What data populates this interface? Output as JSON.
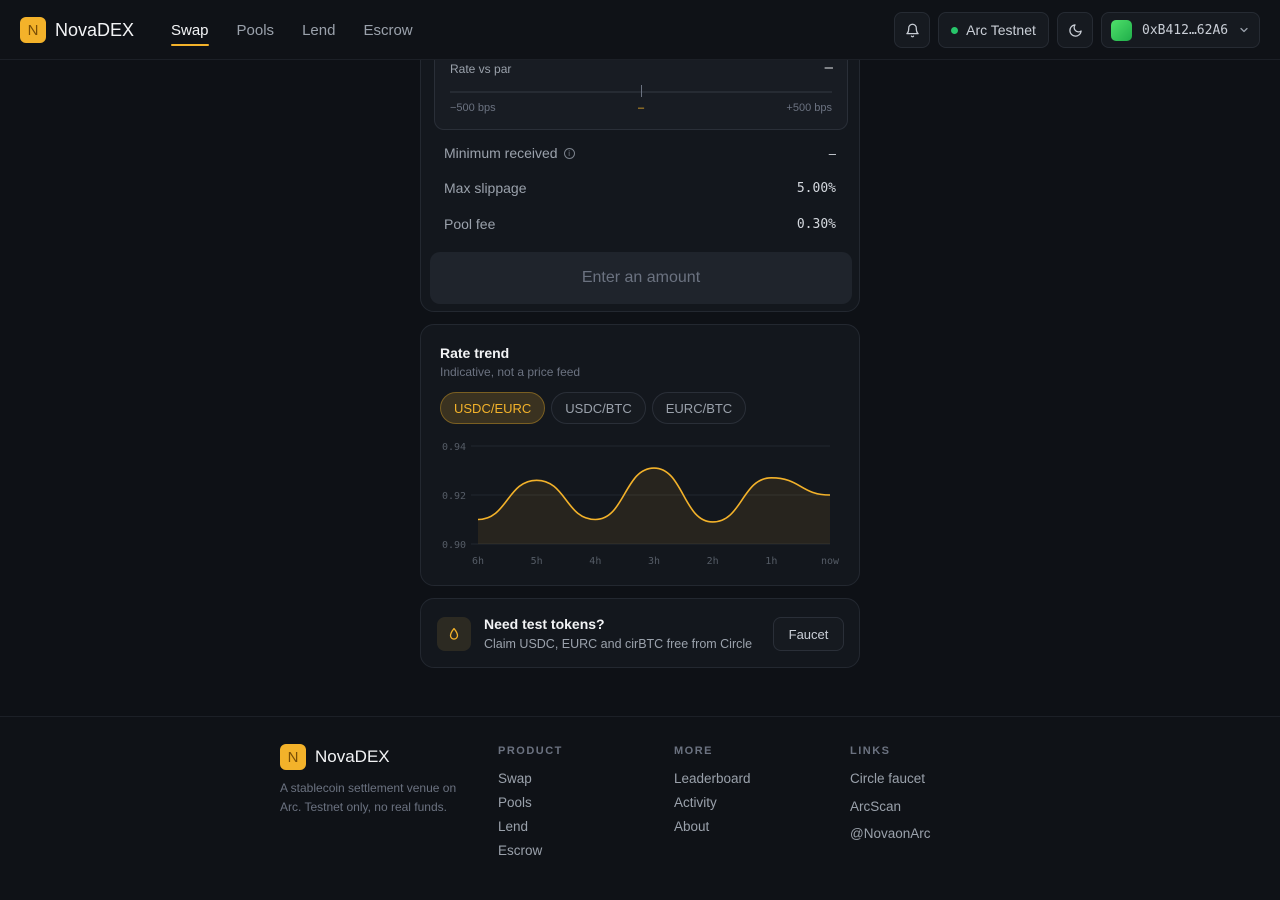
{
  "header": {
    "logo_letter": "N",
    "brand": "NovaDEX",
    "nav": [
      {
        "label": "Swap",
        "active": true
      },
      {
        "label": "Pools",
        "active": false
      },
      {
        "label": "Lend",
        "active": false
      },
      {
        "label": "Escrow",
        "active": false
      }
    ],
    "network": "Arc Testnet",
    "wallet_address": "0xB412…62A6",
    "icons": [
      "bell-icon",
      "moon-icon",
      "chevron-down-icon"
    ]
  },
  "swap": {
    "rate_vs_par_label": "Rate vs par",
    "rate_vs_par_value": "–",
    "scale_min": "−500 bps",
    "scale_mid": "–",
    "scale_max": "+500 bps",
    "minimum_received_label": "Minimum received",
    "minimum_received_value": "–",
    "max_slippage_label": "Max slippage",
    "max_slippage_value": "5.00%",
    "pool_fee_label": "Pool fee",
    "pool_fee_value": "0.30%",
    "cta_label": "Enter an amount"
  },
  "trend": {
    "title": "Rate trend",
    "subtitle": "Indicative, not a price feed",
    "pairs": [
      {
        "label": "USDC/EURC",
        "active": true
      },
      {
        "label": "USDC/BTC",
        "active": false
      },
      {
        "label": "EURC/BTC",
        "active": false
      }
    ]
  },
  "chart_data": {
    "type": "area",
    "x": [
      "6h",
      "5h",
      "4h",
      "3h",
      "2h",
      "1h",
      "now"
    ],
    "series": [
      {
        "values": [
          0.91,
          0.926,
          0.91,
          0.931,
          0.909,
          0.927,
          0.92
        ]
      }
    ],
    "y_ticks": [
      "0.94",
      "0.92",
      "0.90"
    ],
    "ylim": [
      0.9,
      0.94
    ],
    "grid": true,
    "color": "#f3b22a"
  },
  "faucet": {
    "title": "Need test tokens?",
    "subtitle": "Claim USDC, EURC and cirBTC free from Circle",
    "button": "Faucet"
  },
  "footer": {
    "logo_letter": "N",
    "brand": "NovaDEX",
    "description": "A stablecoin settlement venue on Arc. Testnet only, no real funds.",
    "product_title": "PRODUCT",
    "product_links": [
      "Swap",
      "Pools",
      "Lend",
      "Escrow"
    ],
    "more_title": "MORE",
    "more_links": [
      "Leaderboard",
      "Activity",
      "About"
    ],
    "links_title": "LINKS",
    "links_links": [
      "Circle faucet",
      "ArcScan",
      "@NovaonArc"
    ]
  }
}
